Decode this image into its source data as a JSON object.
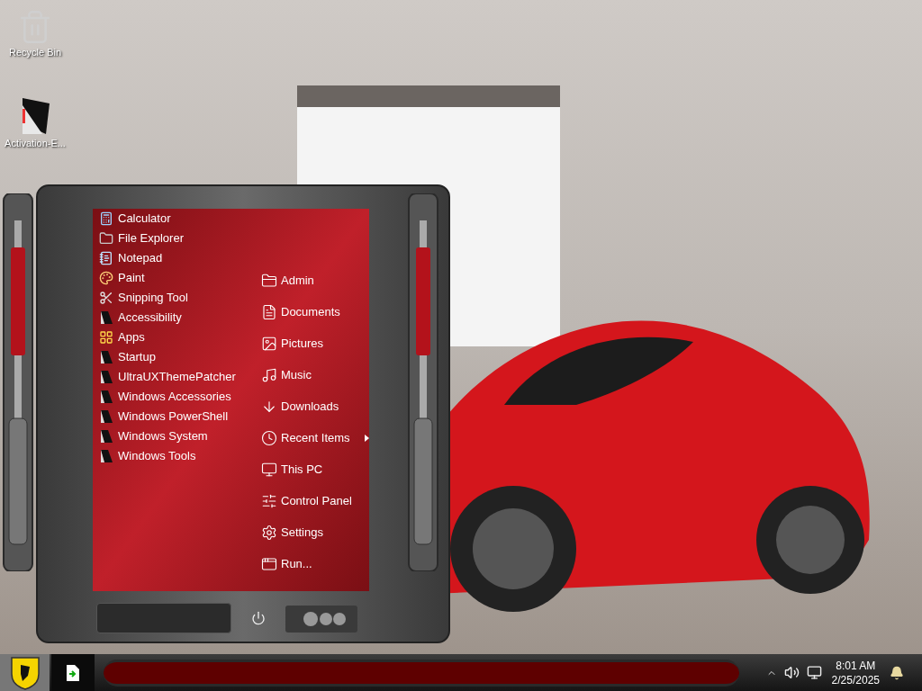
{
  "desktop_icons": [
    {
      "label": "Recycle Bin",
      "kind": "recycle-bin"
    },
    {
      "label": "Activation-E...",
      "kind": "shortcut"
    }
  ],
  "start_menu": {
    "programs": [
      {
        "label": "Calculator",
        "kind": "calculator"
      },
      {
        "label": "File Explorer",
        "kind": "explorer"
      },
      {
        "label": "Notepad",
        "kind": "notepad"
      },
      {
        "label": "Paint",
        "kind": "paint"
      },
      {
        "label": "Snipping Tool",
        "kind": "snip"
      },
      {
        "label": "Accessibility",
        "kind": "folder"
      },
      {
        "label": "Apps",
        "kind": "apps"
      },
      {
        "label": "Startup",
        "kind": "folder"
      },
      {
        "label": "UltraUXThemePatcher",
        "kind": "folder"
      },
      {
        "label": "Windows Accessories",
        "kind": "folder"
      },
      {
        "label": "Windows PowerShell",
        "kind": "folder"
      },
      {
        "label": "Windows System",
        "kind": "folder"
      },
      {
        "label": "Windows Tools",
        "kind": "folder"
      }
    ],
    "places": [
      {
        "label": "Admin",
        "kind": "user",
        "has_submenu": false
      },
      {
        "label": "Documents",
        "kind": "document",
        "has_submenu": false
      },
      {
        "label": "Pictures",
        "kind": "picture",
        "has_submenu": false
      },
      {
        "label": "Music",
        "kind": "music",
        "has_submenu": false
      },
      {
        "label": "Downloads",
        "kind": "download",
        "has_submenu": false
      },
      {
        "label": "Recent Items",
        "kind": "recent",
        "has_submenu": true
      },
      {
        "label": "This PC",
        "kind": "pc",
        "has_submenu": false
      },
      {
        "label": "Control Panel",
        "kind": "control",
        "has_submenu": false
      },
      {
        "label": "Settings",
        "kind": "settings",
        "has_submenu": false
      },
      {
        "label": "Run...",
        "kind": "run",
        "has_submenu": false
      }
    ]
  },
  "taskbar": {
    "clock": {
      "time": "8:01 AM",
      "date": "2/25/2025"
    }
  }
}
